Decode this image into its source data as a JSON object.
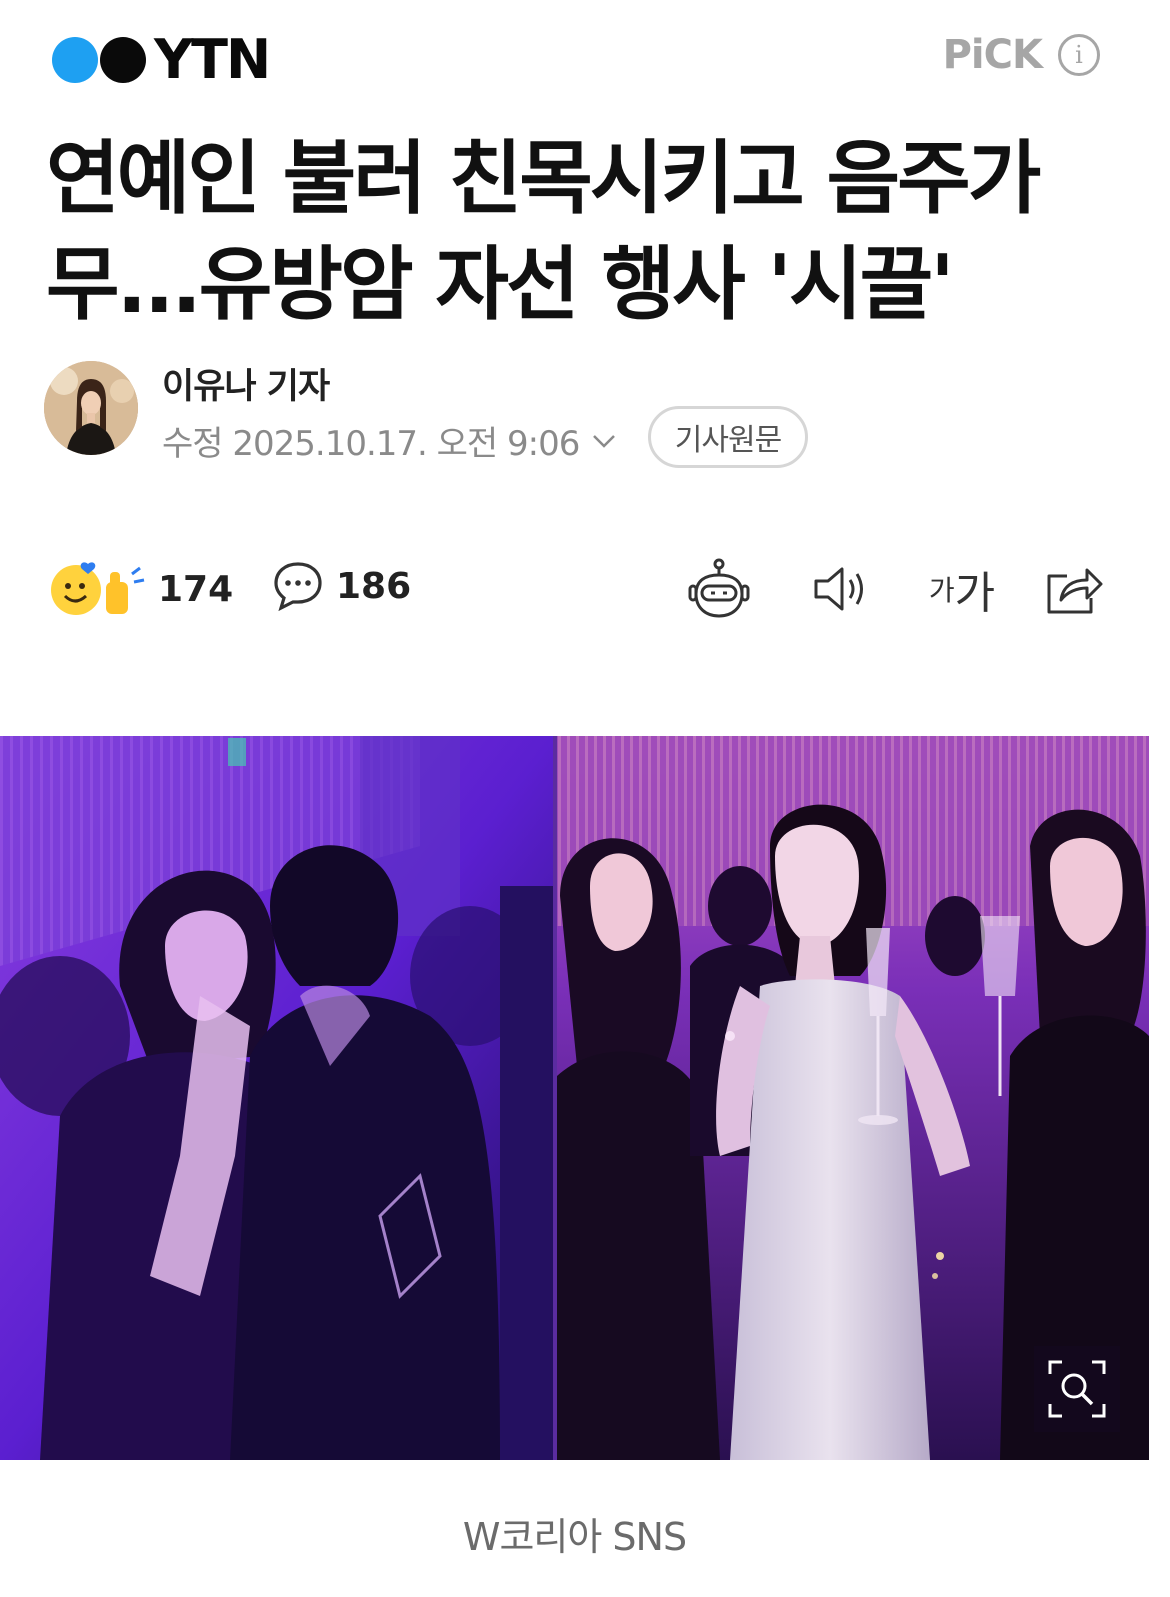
{
  "header": {
    "logo_text": "YTN",
    "pick_label": "PiCK",
    "info_icon": "info-icon"
  },
  "article": {
    "headline": "연예인 불러 친목시키고 음주가무...유방암 자선 행사 '시끌'",
    "reporter": "이유나 기자",
    "modified_label": "수정 2025.10.17. 오전 9:06",
    "original_button": "기사원문"
  },
  "actions": {
    "reaction_count": "174",
    "comment_count": "186",
    "icons": [
      "reaction-emoji-icon",
      "comment-icon",
      "ai-robot-icon",
      "speaker-icon",
      "font-size-icon",
      "share-icon"
    ],
    "font_small": "가",
    "font_big": "가"
  },
  "photo": {
    "caption": "W코리아 SNS",
    "zoom_icon": "zoom-icon"
  },
  "colors": {
    "logo_blue": "#1ea0f2",
    "pick_gray": "#a6a6a6",
    "text_dark": "#111111",
    "meta_gray": "#8a8a8a"
  }
}
